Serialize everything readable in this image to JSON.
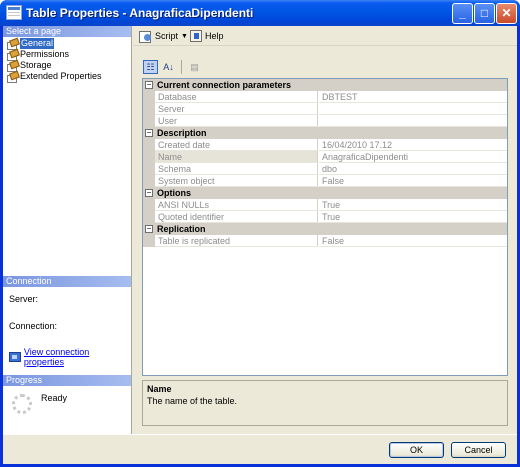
{
  "window": {
    "title": "Table Properties - AnagraficaDipendenti",
    "min": "_",
    "max": "□",
    "close": "✕"
  },
  "left": {
    "select_page_header": "Select a page",
    "pages": [
      "General",
      "Permissions",
      "Storage",
      "Extended Properties"
    ],
    "selected_page": "General",
    "connection_header": "Connection",
    "server_label": "Server:",
    "connection_label": "Connection:",
    "view_connection_link": "View connection properties",
    "progress_header": "Progress",
    "progress_status": "Ready"
  },
  "toolbar": {
    "script_label": "Script",
    "help_label": "Help"
  },
  "grid_toolbar": {
    "categorized": "☷",
    "alphabetical": "A↓",
    "pages": "▤"
  },
  "properties": {
    "categories": [
      {
        "name": "Current connection parameters",
        "toggle": "−",
        "items": [
          {
            "name": "Database",
            "value": "DBTEST"
          },
          {
            "name": "Server",
            "value": ""
          },
          {
            "name": "User",
            "value": ""
          }
        ]
      },
      {
        "name": "Description",
        "toggle": "−",
        "items": [
          {
            "name": "Created date",
            "value": "16/04/2010 17.12"
          },
          {
            "name": "Name",
            "value": "AnagraficaDipendenti"
          },
          {
            "name": "Schema",
            "value": "dbo"
          },
          {
            "name": "System object",
            "value": "False"
          }
        ]
      },
      {
        "name": "Options",
        "toggle": "−",
        "items": [
          {
            "name": "ANSI NULLs",
            "value": "True"
          },
          {
            "name": "Quoted identifier",
            "value": "True"
          }
        ]
      },
      {
        "name": "Replication",
        "toggle": "−",
        "items": [
          {
            "name": "Table is replicated",
            "value": "False"
          }
        ]
      }
    ]
  },
  "description": {
    "title": "Name",
    "text": "The name of the table."
  },
  "buttons": {
    "ok": "OK",
    "cancel": "Cancel"
  },
  "colors": {
    "titlebar": "#0055e5",
    "selection": "#316ac5",
    "link": "#0000ee",
    "face": "#ece9d8"
  }
}
